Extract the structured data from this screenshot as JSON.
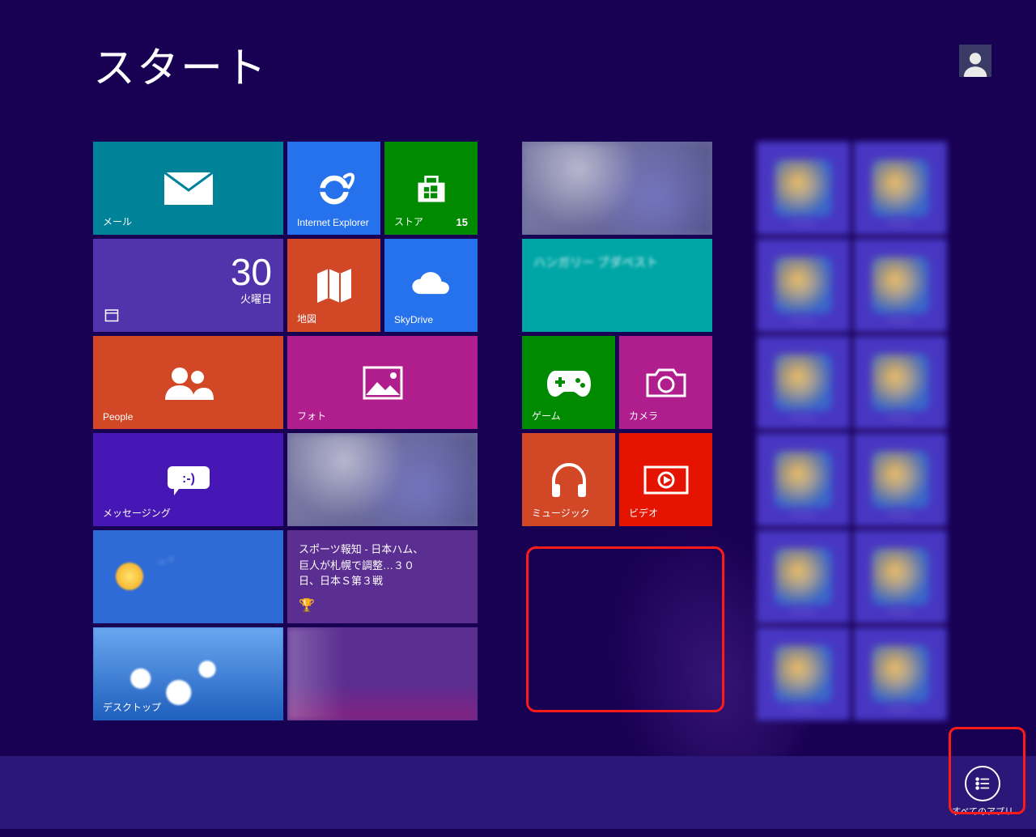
{
  "header": {
    "title": "スタート"
  },
  "tiles": {
    "mail": "メール",
    "ie": "Internet Explorer",
    "store": "ストア",
    "store_badge": "15",
    "calendar_day": "30",
    "calendar_weekday": "火曜日",
    "maps": "地図",
    "skydrive": "SkyDrive",
    "people": "People",
    "photo": "フォト",
    "messaging": "メッセージング",
    "news_headline": "スポーツ報知 - 日本ハム、巨人が札幌で調整…３０日、日本Ｓ第３戦",
    "desktop": "デスクトップ",
    "games": "ゲーム",
    "camera": "カメラ",
    "music": "ミュージック",
    "video": "ビデオ"
  },
  "appbar": {
    "all_apps": "すべてのアプリ"
  }
}
